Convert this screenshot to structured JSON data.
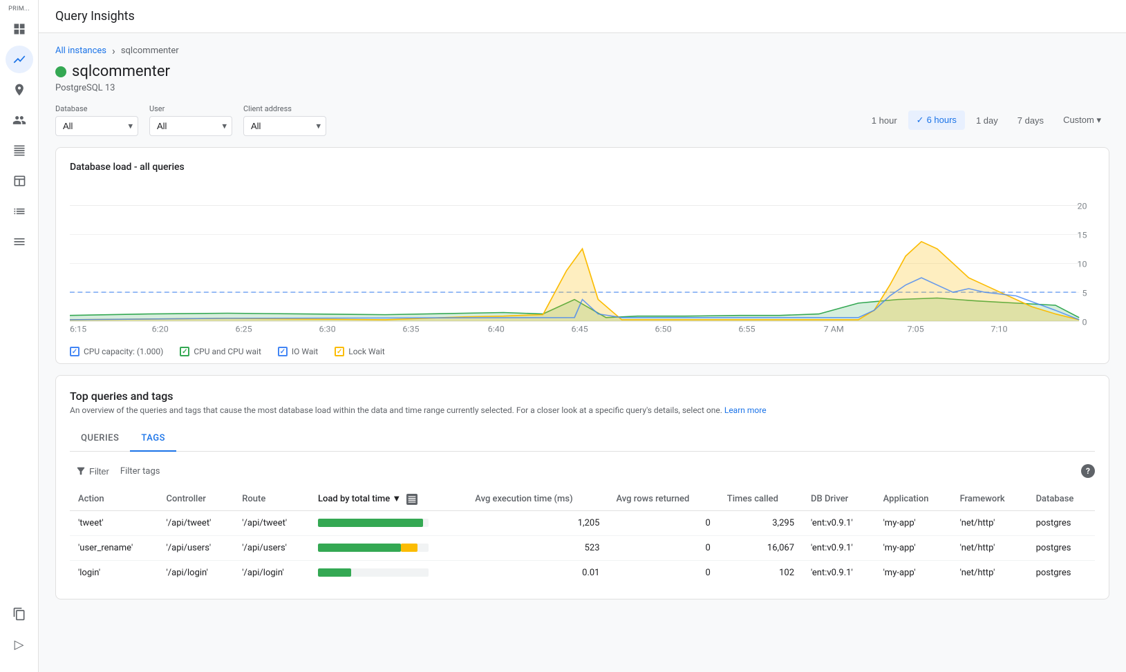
{
  "app": {
    "title": "Query Insights"
  },
  "sidebar": {
    "label": "PRIM...",
    "items": [
      {
        "id": "dashboard",
        "icon": "grid",
        "active": false
      },
      {
        "id": "analytics",
        "icon": "chart",
        "active": true
      },
      {
        "id": "route",
        "icon": "route",
        "active": false
      },
      {
        "id": "users",
        "icon": "users",
        "active": false
      },
      {
        "id": "table",
        "icon": "table",
        "active": false
      },
      {
        "id": "table2",
        "icon": "table2",
        "active": false
      },
      {
        "id": "gantt",
        "icon": "gantt",
        "active": false
      },
      {
        "id": "list",
        "icon": "list",
        "active": false
      }
    ],
    "bottom_items": [
      {
        "id": "copy",
        "icon": "copy"
      }
    ]
  },
  "breadcrumb": {
    "parent": "All instances",
    "current": "sqlcommenter"
  },
  "instance": {
    "name": "sqlcommenter",
    "status": "healthy",
    "db_type": "PostgreSQL 13"
  },
  "filters": {
    "database": {
      "label": "Database",
      "value": "All",
      "options": [
        "All"
      ]
    },
    "user": {
      "label": "User",
      "value": "All",
      "options": [
        "All"
      ]
    },
    "client_address": {
      "label": "Client address",
      "value": "All",
      "options": [
        "All"
      ]
    }
  },
  "time_range": {
    "options": [
      {
        "label": "1 hour",
        "value": "1h",
        "active": false
      },
      {
        "label": "6 hours",
        "value": "6h",
        "active": true
      },
      {
        "label": "1 day",
        "value": "1d",
        "active": false
      },
      {
        "label": "7 days",
        "value": "7d",
        "active": false
      },
      {
        "label": "Custom",
        "value": "custom",
        "active": false
      }
    ]
  },
  "chart": {
    "title": "Database load - all queries",
    "x_labels": [
      "6:15",
      "6:20",
      "6:25",
      "6:30",
      "6:35",
      "6:40",
      "6:45",
      "6:50",
      "6:55",
      "7 AM",
      "7:05",
      "7:10"
    ],
    "y_labels": [
      "0",
      "5",
      "10",
      "15",
      "20"
    ],
    "legend": [
      {
        "label": "CPU capacity: (1.000)",
        "color": "#4285f4",
        "type": "check",
        "checked": true,
        "dashed": true
      },
      {
        "label": "CPU and CPU wait",
        "color": "#34a853",
        "type": "check",
        "checked": true
      },
      {
        "label": "IO Wait",
        "color": "#4285f4",
        "type": "check",
        "checked": true
      },
      {
        "label": "Lock Wait",
        "color": "#fbbc04",
        "type": "check",
        "checked": true
      }
    ]
  },
  "queries_section": {
    "title": "Top queries and tags",
    "description": "An overview of the queries and tags that cause the most database load within the data and time range currently selected. For a closer look at a specific query's details, select one.",
    "learn_more": "Learn more",
    "tabs": [
      {
        "label": "QUERIES",
        "active": false
      },
      {
        "label": "TAGS",
        "active": true
      }
    ],
    "table": {
      "filter_label": "Filter",
      "filter_tags_label": "Filter tags",
      "columns": [
        {
          "label": "Action",
          "sortable": false
        },
        {
          "label": "Controller",
          "sortable": false
        },
        {
          "label": "Route",
          "sortable": false
        },
        {
          "label": "Load by total time",
          "sortable": true,
          "sort_active": true
        },
        {
          "label": "Avg execution time (ms)",
          "sortable": false
        },
        {
          "label": "Avg rows returned",
          "sortable": false
        },
        {
          "label": "Times called",
          "sortable": false
        },
        {
          "label": "DB Driver",
          "sortable": false
        },
        {
          "label": "Application",
          "sortable": false
        },
        {
          "label": "Framework",
          "sortable": false
        },
        {
          "label": "Database",
          "sortable": false
        }
      ],
      "rows": [
        {
          "action": "'tweet'",
          "controller": "'/api/tweet'",
          "route": "'/api/tweet'",
          "load_green": 95,
          "load_orange": 0,
          "avg_exec": "1,205",
          "avg_rows": "0",
          "times_called": "3,295",
          "db_driver": "'ent:v0.9.1'",
          "application": "'my-app'",
          "framework": "'net/http'",
          "database": "postgres"
        },
        {
          "action": "'user_rename'",
          "controller": "'/api/users'",
          "route": "'/api/users'",
          "load_green": 75,
          "load_orange": 15,
          "avg_exec": "523",
          "avg_rows": "0",
          "times_called": "16,067",
          "db_driver": "'ent:v0.9.1'",
          "application": "'my-app'",
          "framework": "'net/http'",
          "database": "postgres"
        },
        {
          "action": "'login'",
          "controller": "'/api/login'",
          "route": "'/api/login'",
          "load_green": 30,
          "load_orange": 0,
          "avg_exec": "0.01",
          "avg_rows": "0",
          "times_called": "102",
          "db_driver": "'ent:v0.9.1'",
          "application": "'my-app'",
          "framework": "'net/http'",
          "database": "postgres"
        }
      ]
    }
  }
}
